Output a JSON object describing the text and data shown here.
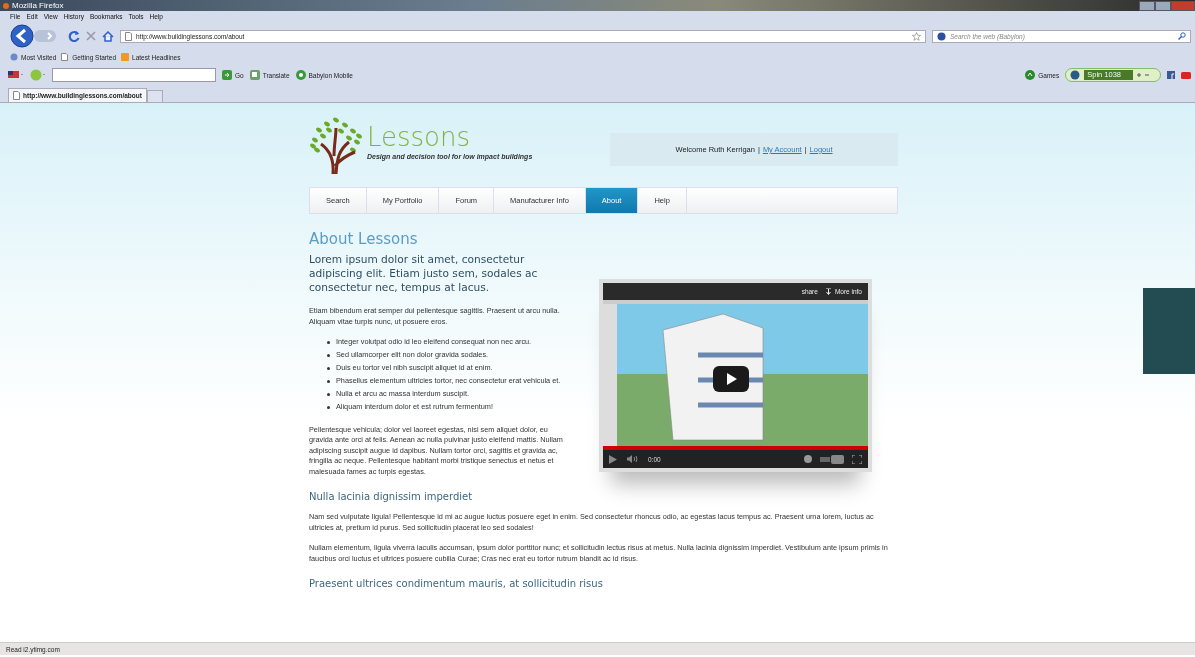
{
  "window": {
    "title": "Mozilla Firefox"
  },
  "menu_bar": [
    "File",
    "Edit",
    "View",
    "History",
    "Bookmarks",
    "Tools",
    "Help"
  ],
  "nav_bar": {
    "url": "http://www.buildinglessons.com/about",
    "search_placeholder": "Search the web (Babylon)"
  },
  "bookmarks": [
    "Most Visited",
    "Getting Started",
    "Latest Headlines"
  ],
  "toolbar": {
    "buttons": [
      {
        "kind": "go",
        "label": "Go"
      },
      {
        "kind": "translate",
        "label": "Translate"
      },
      {
        "kind": "mobile",
        "label": "Babylon Mobile"
      }
    ],
    "games": "Games",
    "radio_station": "Spin 1038"
  },
  "tabs": [
    {
      "label": "http://www.buildinglessons.com/about",
      "selected": true
    }
  ],
  "site": {
    "brand": "Lessons",
    "tagline": "Design and decision tool for low impact buildings",
    "user_box": [
      {
        "kind": "text",
        "text": "Welcome Ruth Kerrigan"
      },
      {
        "kind": "sep",
        "text": "|"
      },
      {
        "kind": "link",
        "text": "My Account"
      },
      {
        "kind": "sep",
        "text": "|"
      },
      {
        "kind": "link",
        "text": "Logout"
      }
    ],
    "nav": [
      {
        "label": "Search",
        "selected": false
      },
      {
        "label": "My Portfolio",
        "selected": false
      },
      {
        "label": "Forum",
        "selected": false
      },
      {
        "label": "Manufacturer Info",
        "selected": false
      },
      {
        "label": "About",
        "selected": true
      },
      {
        "label": "Help",
        "selected": false
      }
    ],
    "title": "About Lessons",
    "lead": "Lorem ipsum dolor sit amet, consectetur adipiscing elit. Etiam justo sem, sodales ac consectetur nec, tempus at lacus.",
    "intro": "Etiam bibendum erat semper dui pellentesque sagittis. Praesent ut arcu nulla. Aliquam vitae turpis nunc, ut posuere eros.",
    "bullets": [
      "Integer volutpat odio id leo eleifend consequat non nec arcu.",
      "Sed ullamcorper elit non dolor gravida sodales.",
      "Duis eu tortor vel nibh suscipit aliquet id at enim.",
      "Phasellus elementum ultricies tortor, nec consectetur erat vehicula et.",
      "Nulla et arcu ac massa interdum suscipit.",
      "Aliquam interdum dolor et est rutrum fermentum!"
    ],
    "body": "Pellentesque vehicula; dolor vel laoreet egestas, nisi sem aliquet dolor, eu gravida ante orci at felis. Aenean ac nulla pulvinar justo eleifend mattis. Nullam adipiscing suscipit augue id dapibus. Nullam tortor orci, sagittis et gravida ac, fringilla ac neque. Pellentesque habitant morbi tristique senectus et netus et malesuada fames ac turpis egestas.",
    "video": {
      "share": "share",
      "more_info": "More info",
      "time": "0:00",
      "progress": {
        "level": 1
      }
    },
    "sections": [
      {
        "heading": "Nulla lacinia dignissim imperdiet",
        "paragraphs": [
          "Nam sed vulputate ligula! Pellentesque id mi ac augue luctus posuere eget in enim. Sed consectetur rhoncus odio, ac egestas lacus tempus ac. Praesent urna lorem, luctus ac ultricies at, pretium id purus. Sed sollicitudin placerat leo sed sodales!",
          "Nullam elementum, ligula viverra iaculis accumsan, ipsum dolor porttitor nunc; et sollicitudin lectus risus at metus. Nulla lacinia dignissim imperdiet. Vestibulum ante ipsum primis in faucibus orci luctus et ultrices posuere cubilia Curae; Cras nec erat eu tortor rutrum blandit ac id risus."
        ]
      },
      {
        "heading": "Praesent ultrices condimentum mauris, at sollicitudin risus"
      }
    ]
  },
  "status_bar": "Read i2.ytimg.com"
}
